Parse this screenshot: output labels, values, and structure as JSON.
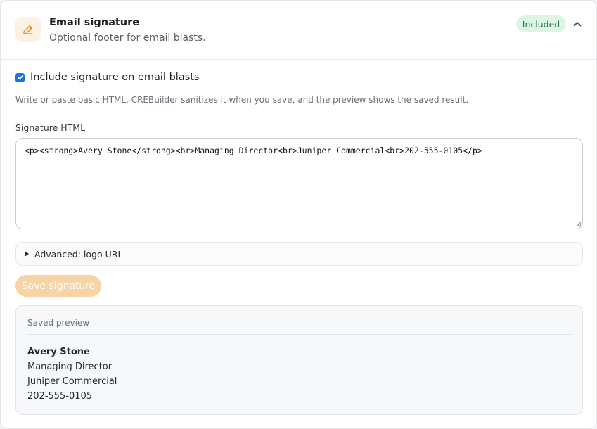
{
  "section": {
    "title": "Email signature",
    "subtitle": "Optional footer for email blasts.",
    "badge": "Included",
    "header_icon": "pencil-icon",
    "collapse_icon": "chevron-up-icon"
  },
  "include_checkbox": {
    "label": "Include signature on email blasts",
    "checked": true
  },
  "help_text": "Write or paste basic HTML. CREBuilder sanitizes it when you save, and the preview shows the saved result.",
  "signature_field": {
    "label": "Signature HTML",
    "value": "<p><strong>Avery Stone</strong><br>Managing Director<br>Juniper Commercial<br>202-555-0105</p>"
  },
  "advanced": {
    "label": "Advanced: logo URL"
  },
  "save_button": {
    "label": "Save signature"
  },
  "preview": {
    "label": "Saved preview",
    "name": "Avery Stone",
    "title": "Managing Director",
    "company": "Juniper Commercial",
    "phone": "202-555-0105"
  },
  "colors": {
    "accent": "#e8891c",
    "badge_bg": "#dcf5e4",
    "badge_text": "#237a45",
    "checkbox": "#1a73e8",
    "save_button_bg": "#f8d3a6"
  }
}
